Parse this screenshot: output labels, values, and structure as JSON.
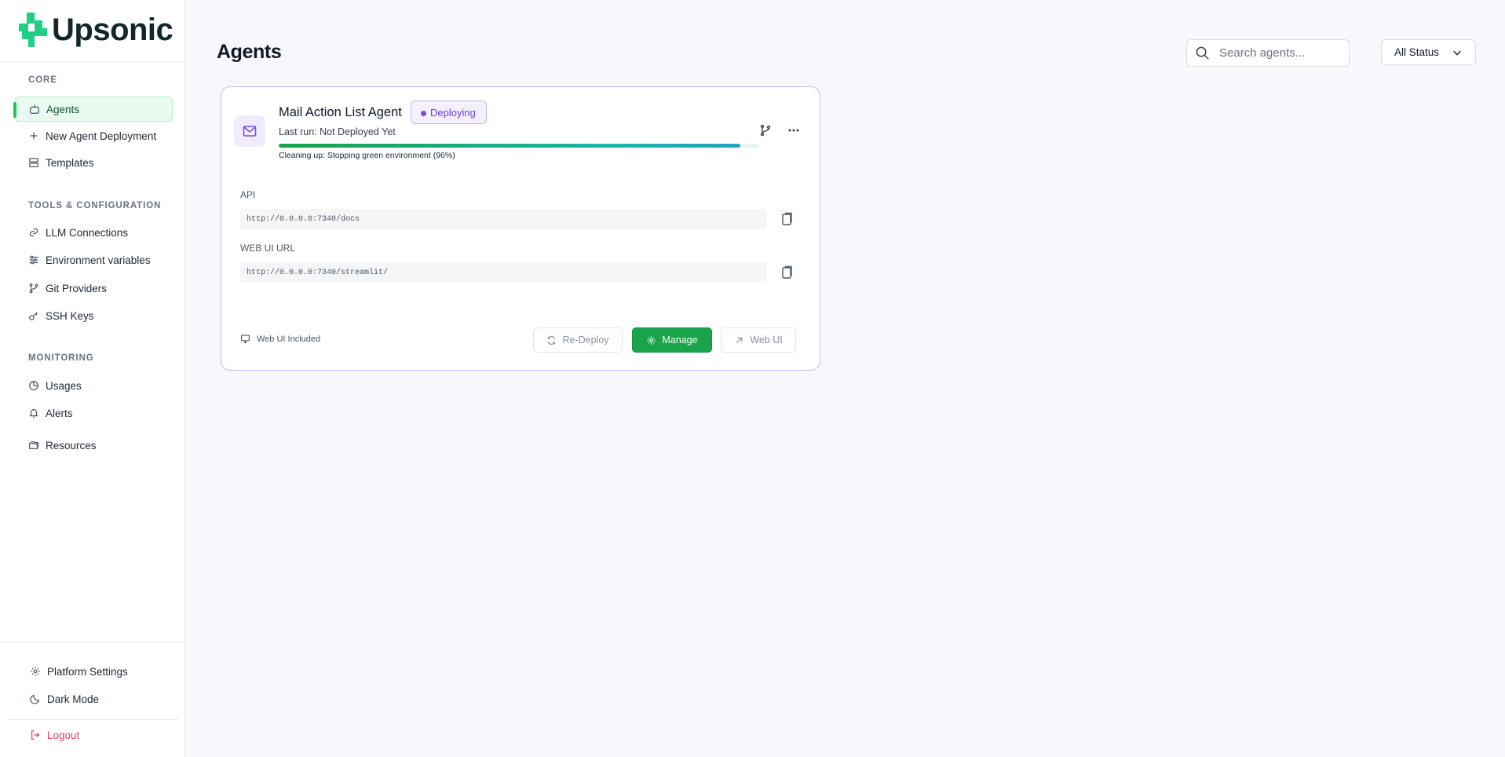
{
  "brand": {
    "name": "Upsonic",
    "accent": "#22c55e"
  },
  "sidebar": {
    "sections": [
      {
        "label": "CORE"
      },
      {
        "label": "TOOLS & CONFIGURATION"
      },
      {
        "label": "MONITORING"
      }
    ],
    "items": [
      {
        "label": "Agents",
        "icon": "robot-icon",
        "active": true
      },
      {
        "label": "New Agent Deployment",
        "icon": "plus-icon"
      },
      {
        "label": "Templates",
        "icon": "layout-icon"
      },
      {
        "label": "LLM Connections",
        "icon": "link-icon"
      },
      {
        "label": "Environment variables",
        "icon": "sliders-icon"
      },
      {
        "label": "Git Providers",
        "icon": "git-branch-icon"
      },
      {
        "label": "SSH Keys",
        "icon": "key-icon"
      },
      {
        "label": "Usages",
        "icon": "pie-chart-icon"
      },
      {
        "label": "Alerts",
        "icon": "bell-icon"
      },
      {
        "label": "Resources",
        "icon": "folders-icon"
      }
    ],
    "bottom": [
      {
        "label": "Platform Settings",
        "icon": "gear-icon"
      },
      {
        "label": "Dark Mode",
        "icon": "moon-icon"
      },
      {
        "label": "Logout",
        "icon": "logout-icon"
      }
    ]
  },
  "header": {
    "title": "Agents",
    "search_placeholder": "Search agents...",
    "status_filter": "All Status"
  },
  "agent_card": {
    "name": "Mail Action List Agent",
    "status": "Deploying",
    "status_color": "#7c4ddc",
    "last_run": "Last run: Not Deployed Yet",
    "progress": 0.96,
    "progress_text": "Cleaning up: Stopping green environment (96%)",
    "api_label": "API",
    "api_url": "http://0.0.0.0:7340/docs",
    "webui_label": "WEB UI URL",
    "webui_url": "http://0.0.0.0:7340/streamlit/",
    "webui_included": "Web UI Included",
    "redeploy_label": "Re-Deploy",
    "manage_label": "Manage",
    "webui_button_label": "Web UI",
    "manage_color": "#1aa34a"
  }
}
